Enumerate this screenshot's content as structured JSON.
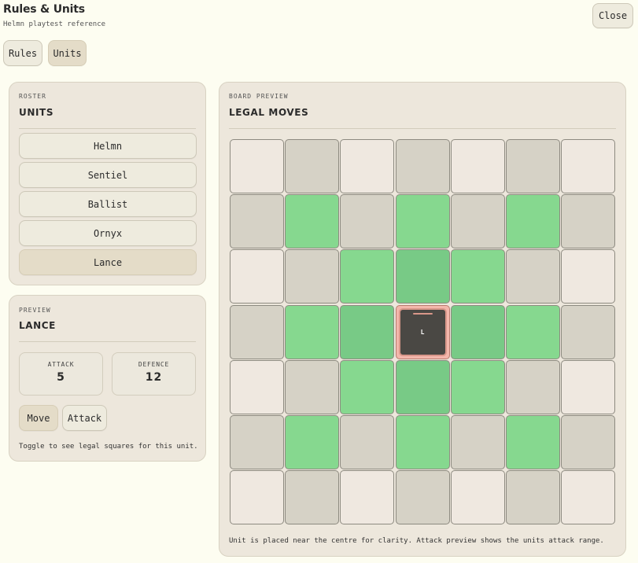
{
  "header": {
    "title": "Rules & Units",
    "subtitle": "Helmn playtest reference",
    "close_label": "Close"
  },
  "tabs": [
    {
      "label": "Rules",
      "active": false
    },
    {
      "label": "Units",
      "active": true
    }
  ],
  "roster": {
    "kicker": "ROSTER",
    "title": "UNITS",
    "units": [
      "Helmn",
      "Sentiel",
      "Ballist",
      "Ornyx",
      "Lance"
    ],
    "selected_index": 4
  },
  "preview": {
    "kicker": "PREVIEW",
    "title": "LANCE",
    "attack_label": "ATTACK",
    "attack_value": "5",
    "defence_label": "DEFENCE",
    "defence_value": "12",
    "mode_move_label": "Move",
    "mode_attack_label": "Attack",
    "active_mode": "move",
    "hint": "Toggle to see legal squares for this unit."
  },
  "board": {
    "kicker": "BOARD PREVIEW",
    "title": "LEGAL MOVES",
    "size": 7,
    "piece_label": "L",
    "piece_row": 3,
    "piece_col": 3,
    "legal_moves": [
      [
        1,
        1
      ],
      [
        1,
        3
      ],
      [
        1,
        5
      ],
      [
        2,
        2
      ],
      [
        2,
        3
      ],
      [
        2,
        4
      ],
      [
        3,
        1
      ],
      [
        3,
        2
      ],
      [
        3,
        4
      ],
      [
        3,
        5
      ],
      [
        4,
        2
      ],
      [
        4,
        3
      ],
      [
        4,
        4
      ],
      [
        5,
        1
      ],
      [
        5,
        3
      ],
      [
        5,
        5
      ]
    ],
    "note": "Unit is placed near the centre for clarity. Attack preview shows the units attack range."
  },
  "colors": {
    "light_square": "#efe8e0",
    "dark_square": "#d6d2c6",
    "legal_move": "#86d88f",
    "piece": "#4a4844",
    "piece_outline": "#d9978a"
  }
}
